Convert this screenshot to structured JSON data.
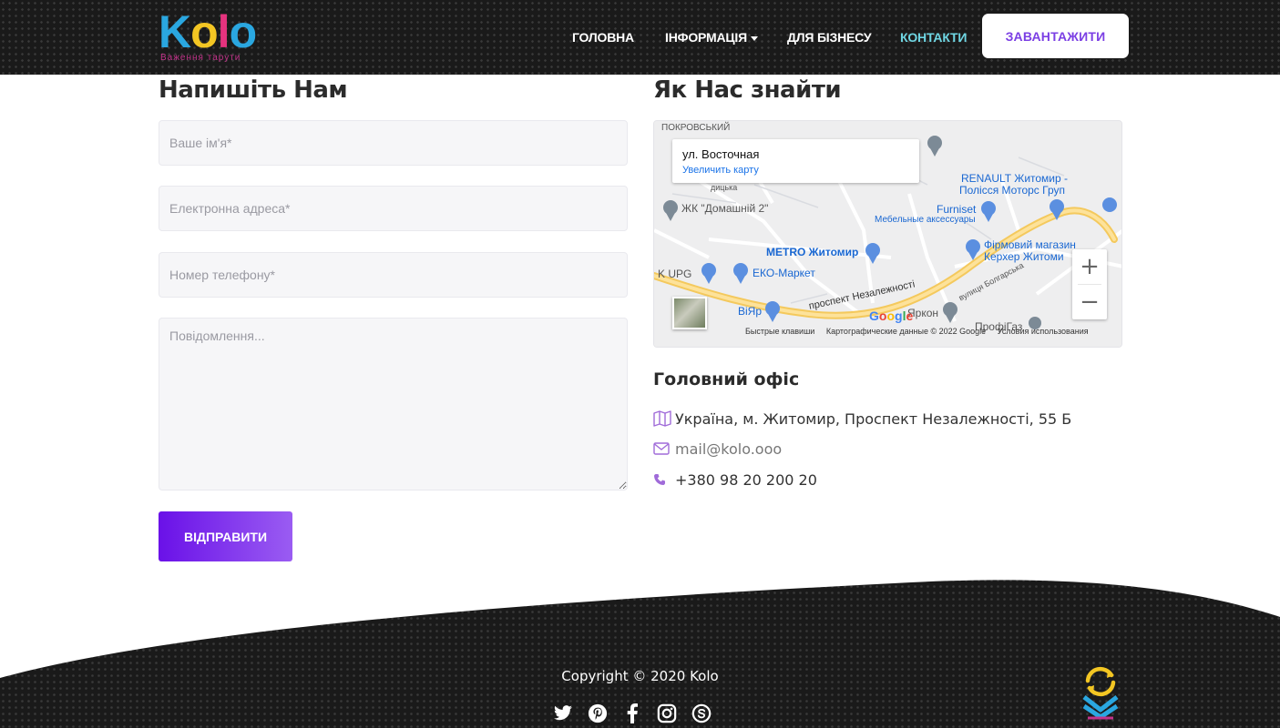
{
  "header": {
    "logo": {
      "k": "K",
      "o1": "o",
      "l": "l",
      "o2": "o",
      "tagline": "Важення тарути"
    },
    "nav": [
      {
        "label": "ГОЛОВНА"
      },
      {
        "label": "ІНФОРМАЦІЯ"
      },
      {
        "label": "ДЛЯ БІЗНЕСУ"
      },
      {
        "label": "КОНТАКТИ"
      }
    ],
    "download_label": "ЗАВАНТАЖИТИ"
  },
  "form": {
    "title": "Напишіть Нам",
    "name_placeholder": "Ваше ім'я*",
    "email_placeholder": "Електронна адреса*",
    "phone_placeholder": "Номер телефону*",
    "message_placeholder": "Повідомлення...",
    "submit_label": "ВІДПРАВИТИ"
  },
  "location": {
    "title": "Як Нас знайти",
    "map": {
      "card_title": "ул. Восточная",
      "card_link": "Увеличить карту",
      "zoom_in": "+",
      "zoom_out": "−",
      "footer": [
        "Быстрые клавиши",
        "Картографические данные © 2022 Google",
        "Условия использования"
      ],
      "google": "Google",
      "labels": {
        "renault1": "RENAULT Житомир -",
        "renault2": "Полісся Моторс Груп",
        "furniset": "Furniset",
        "furniset_sub": "Мебельные аксессуары",
        "home": "ЖК \"Домашній 2\"",
        "metro": "METRO Житомир",
        "karcher1": "Фірмовий магазин",
        "karcher2": "Керхер Житоми",
        "upg": "K UPG",
        "eko": "ЕКО-Маркет",
        "viyar": "ВіЯр",
        "road": "проспект Незалежності",
        "yarkon": "Яркон",
        "bolgar": "вулиця Болгарська",
        "profi": "ПрофіГаз",
        "pokrov": "ПОКРОВСЬКИЙ",
        "dytsk": "дицька"
      }
    },
    "office_title": "Головний офіс",
    "address": "Україна, м. Житомир, Проспект Незалежності, 55 Б",
    "email": "mail@kolo.ooo",
    "phone": "+380 98 20 200 20"
  },
  "footer": {
    "copyright": "Copyright © 2020 Kolo",
    "socials": [
      "twitter-icon",
      "pinterest-icon",
      "facebook-icon",
      "instagram-icon",
      "skype-icon"
    ]
  },
  "colors": {
    "accent": "#7b3fe4",
    "active_nav": "#6fd6e3",
    "header_bg": "#1a1a1a"
  }
}
